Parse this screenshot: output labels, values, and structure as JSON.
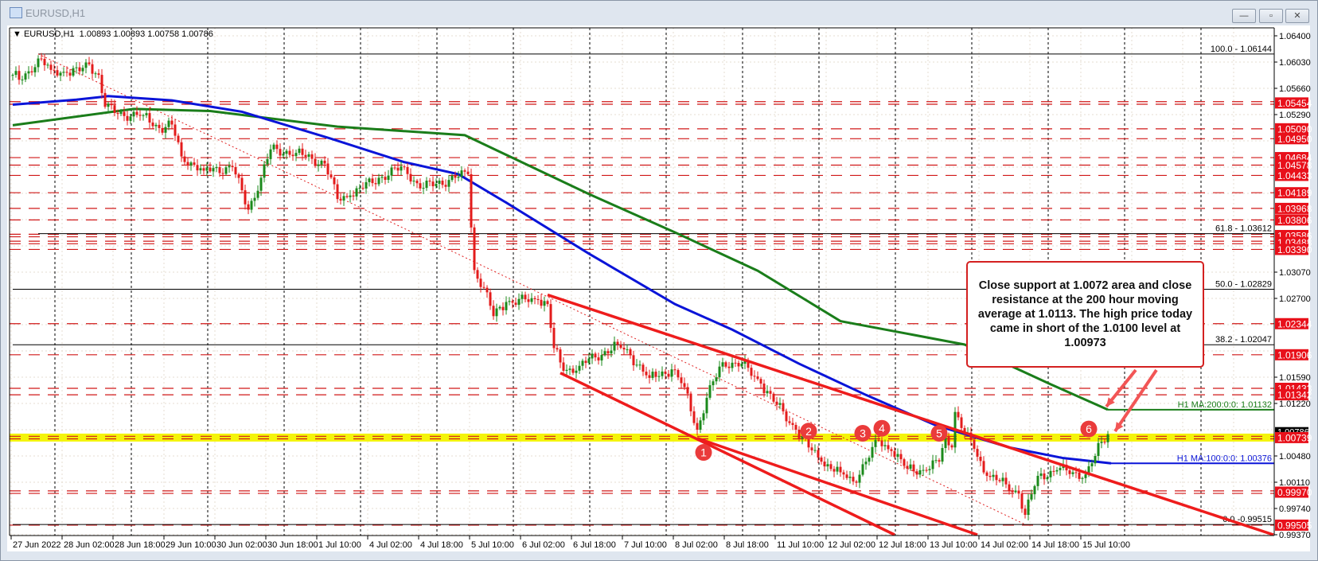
{
  "window": {
    "title": "EURUSD,H1",
    "minimize": "—",
    "restore": "▫",
    "close": "✕"
  },
  "header": {
    "arrow": "▼",
    "symbol": "EURUSD,H1",
    "ohlc": "1.00893 1.00893 1.00758 1.00786"
  },
  "callout": {
    "text": "Close support at 1.0072 area and close resistance at the 200 hour moving average at 1.0113. The high price today came in short of the 1.0100 level at 1.00973"
  },
  "colors": {
    "bull": "#1b8a1b",
    "bear": "#e31b1b",
    "ma100": "#0a14d8",
    "ma200": "#1a7d1a",
    "level": "#d01818",
    "highlight": "#f4f40a",
    "trend": "#ee1c1c",
    "arrow": "#f25555",
    "marker": "#ea3b3b"
  },
  "chart_data": {
    "type": "candlestick",
    "title": "EURUSD,H1",
    "ylim": [
      0.9937,
      1.064
    ],
    "y_ticks": [
      "1.06400",
      "1.06030",
      "1.05660",
      "1.05290",
      "1.03070",
      "1.02700",
      "1.01590",
      "1.01220",
      "1.00480",
      "1.00110",
      "0.99740",
      "0.99370"
    ],
    "y_tick_values": [
      1.064,
      1.0603,
      1.0566,
      1.0529,
      1.0307,
      1.027,
      1.0159,
      1.0122,
      1.0048,
      1.0011,
      0.9974,
      0.9937
    ],
    "x_labels": [
      "27 Jun 2022",
      "28 Jun 02:00",
      "28 Jun 18:00",
      "29 Jun 10:00",
      "30 Jun 02:00",
      "30 Jun 18:00",
      "1 Jul 10:00",
      "4 Jul 02:00",
      "4 Jul 18:00",
      "5 Jul 10:00",
      "6 Jul 02:00",
      "6 Jul 18:00",
      "7 Jul 10:00",
      "8 Jul 02:00",
      "8 Jul 18:00",
      "11 Jul 10:00",
      "12 Jul 02:00",
      "12 Jul 18:00",
      "13 Jul 10:00",
      "14 Jul 02:00",
      "14 Jul 18:00",
      "15 Jul 10:00"
    ],
    "x_label_bar_step": 16,
    "last_bar_index": 344,
    "price_path": [
      [
        0,
        1.0585
      ],
      [
        2,
        1.0578
      ],
      [
        5,
        1.059
      ],
      [
        8,
        1.0608
      ],
      [
        12,
        1.0592
      ],
      [
        17,
        1.0588
      ],
      [
        21,
        1.059
      ],
      [
        24,
        1.06
      ],
      [
        27,
        1.0585
      ],
      [
        29,
        1.054
      ],
      [
        33,
        1.053
      ],
      [
        41,
        1.0528
      ],
      [
        46,
        1.051
      ],
      [
        50,
        1.0515
      ],
      [
        53,
        1.047
      ],
      [
        60,
        1.045
      ],
      [
        69,
        1.0455
      ],
      [
        74,
        1.0395
      ],
      [
        78,
        1.044
      ],
      [
        81,
        1.048
      ],
      [
        89,
        1.0475
      ],
      [
        98,
        1.046
      ],
      [
        102,
        1.041
      ],
      [
        106,
        1.0415
      ],
      [
        115,
        1.044
      ],
      [
        123,
        1.0455
      ],
      [
        128,
        1.0425
      ],
      [
        139,
        1.044
      ],
      [
        143,
        1.0445
      ],
      [
        144,
        1.037
      ],
      [
        145,
        1.031
      ],
      [
        148,
        1.0285
      ],
      [
        151,
        1.0245
      ],
      [
        155,
        1.0265
      ],
      [
        165,
        1.0268
      ],
      [
        168,
        1.0262
      ],
      [
        170,
        1.02
      ],
      [
        173,
        1.0168
      ],
      [
        178,
        1.0175
      ],
      [
        190,
        1.0205
      ],
      [
        194,
        1.019
      ],
      [
        200,
        1.0158
      ],
      [
        207,
        1.017
      ],
      [
        211,
        1.0145
      ],
      [
        215,
        1.0085
      ],
      [
        218,
        1.013
      ],
      [
        223,
        1.018
      ],
      [
        229,
        1.0178
      ],
      [
        235,
        1.015
      ],
      [
        240,
        1.012
      ],
      [
        246,
        1.0085
      ],
      [
        250,
        1.006
      ],
      [
        254,
        1.004
      ],
      [
        260,
        1.0025
      ],
      [
        264,
        1.0012
      ],
      [
        268,
        1.004
      ],
      [
        272,
        1.007
      ],
      [
        276,
        1.0055
      ],
      [
        281,
        1.003
      ],
      [
        287,
        1.0028
      ],
      [
        291,
        1.004
      ],
      [
        293,
        1.0075
      ],
      [
        295,
        1.006
      ],
      [
        296,
        1.011
      ],
      [
        299,
        1.008
      ],
      [
        302,
        1.0058
      ],
      [
        306,
        1.002
      ],
      [
        312,
        1.0008
      ],
      [
        316,
        0.9995
      ],
      [
        318,
        0.9965
      ],
      [
        322,
        1.002
      ],
      [
        328,
        1.0028
      ],
      [
        333,
        1.0025
      ],
      [
        337,
        1.0022
      ],
      [
        340,
        1.0048
      ],
      [
        342,
        1.0068
      ],
      [
        344,
        1.00786
      ]
    ],
    "ma100": {
      "label": "H1 MA:100:0:0: 1.00376",
      "value": 1.00376,
      "points": [
        [
          0,
          1.0543
        ],
        [
          20,
          1.055
        ],
        [
          30,
          1.0555
        ],
        [
          50,
          1.0549
        ],
        [
          72,
          1.0533
        ],
        [
          100,
          1.0495
        ],
        [
          123,
          1.0462
        ],
        [
          140,
          1.0445
        ],
        [
          155,
          1.0405
        ],
        [
          181,
          1.0333
        ],
        [
          208,
          1.0262
        ],
        [
          226,
          1.0226
        ],
        [
          247,
          1.0178
        ],
        [
          268,
          1.0134
        ],
        [
          290,
          1.0091
        ],
        [
          313,
          1.006
        ],
        [
          330,
          1.0045
        ],
        [
          345,
          1.00376
        ]
      ]
    },
    "ma200": {
      "label": "H1 MA:200:0:0: 1.01132",
      "value": 1.01132,
      "points": [
        [
          0,
          1.0514
        ],
        [
          38,
          1.0537
        ],
        [
          62,
          1.0534
        ],
        [
          102,
          1.0512
        ],
        [
          142,
          1.05
        ],
        [
          181,
          1.0417
        ],
        [
          208,
          1.0363
        ],
        [
          234,
          1.0309
        ],
        [
          260,
          1.0238
        ],
        [
          299,
          1.0205
        ],
        [
          326,
          1.0149
        ],
        [
          344,
          1.01132
        ]
      ]
    },
    "levels": [
      {
        "label": "1.05454",
        "value": 1.05454,
        "double": true
      },
      {
        "label": "1.05090",
        "value": 1.0509
      },
      {
        "label": "1.04950",
        "value": 1.0495
      },
      {
        "label": "1.04684",
        "value": 1.04684
      },
      {
        "label": "1.04578",
        "value": 1.04578
      },
      {
        "label": "1.04433",
        "value": 1.04433
      },
      {
        "label": "1.04189",
        "value": 1.04189
      },
      {
        "label": "1.03968",
        "value": 1.03968
      },
      {
        "label": "1.03806",
        "value": 1.03806
      },
      {
        "label": "1.03586",
        "value": 1.03586,
        "double": true
      },
      {
        "label": "1.03488",
        "value": 1.03488,
        "double": true
      },
      {
        "label": "1.03390",
        "value": 1.0339
      },
      {
        "label": "1.02344",
        "value": 1.02344
      },
      {
        "label": "1.01906",
        "value": 1.01906
      },
      {
        "label": "1.01433",
        "value": 1.01433
      },
      {
        "label": "1.01342",
        "value": 1.01342
      },
      {
        "label": "1.00739",
        "value": 1.00739,
        "double": true,
        "highlight": true
      },
      {
        "label": "0.99970",
        "value": 0.9997,
        "double": true
      },
      {
        "label": "0.99505",
        "value": 0.99505
      }
    ],
    "current_price": {
      "label": "1.00786",
      "value": 1.00786
    },
    "fibonacci": [
      {
        "label": "100.0 - 1.06144",
        "value": 1.06144,
        "start_bar": 8
      },
      {
        "label": "61.8 - 1.03612",
        "value": 1.03612,
        "start_bar": 8
      },
      {
        "label": "50.0 - 1.02829",
        "value": 1.02829,
        "start_bar": 0
      },
      {
        "label": "38.2 - 1.02047",
        "value": 1.02047,
        "start_bar": 0
      },
      {
        "label": "0.0 -0.99515",
        "value": 0.99515,
        "start_bar": 0
      }
    ],
    "trendlines": [
      {
        "from": [
          168,
          1.0275
        ],
        "to": [
          396,
          0.9937
        ]
      },
      {
        "from": [
          172,
          1.0165
        ],
        "to": [
          277,
          0.9937
        ]
      },
      {
        "from": [
          215,
          1.0073
        ],
        "to": [
          303,
          0.9937
        ]
      }
    ],
    "fib_diagonal": {
      "from": [
        8,
        1.06144
      ],
      "to": [
        318,
        0.99515
      ]
    },
    "markers": [
      {
        "label": "1",
        "bar": 217,
        "price": 1.0053
      },
      {
        "label": "2",
        "bar": 250,
        "price": 1.0083
      },
      {
        "label": "3",
        "bar": 267,
        "price": 1.008
      },
      {
        "label": "4",
        "bar": 273,
        "price": 1.0087
      },
      {
        "label": "5",
        "bar": 291,
        "price": 1.008
      },
      {
        "label": "6",
        "bar": 338,
        "price": 1.0086
      }
    ]
  }
}
